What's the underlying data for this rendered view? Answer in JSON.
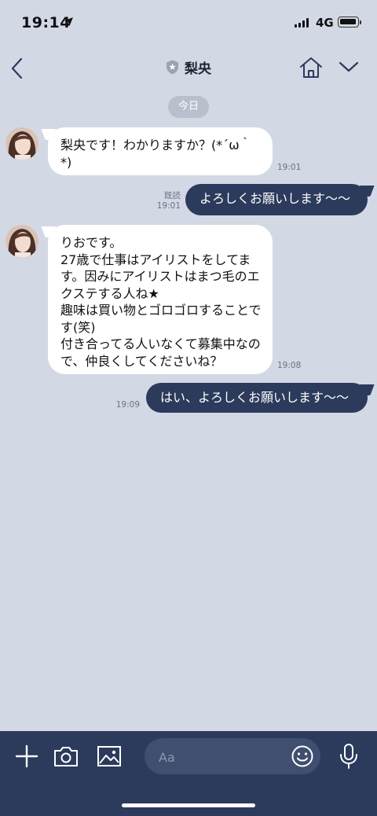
{
  "status": {
    "time": "19:14",
    "network": "4G"
  },
  "header": {
    "title": "梨央"
  },
  "date_label": "今日",
  "messages": [
    {
      "side": "in",
      "text": "梨央です！わかりますか？(*´ω｀*)",
      "time": "19:01"
    },
    {
      "side": "out",
      "text": "よろしくお願いします〜〜",
      "read": "既読",
      "time": "19:01"
    },
    {
      "side": "in",
      "text": "りおです。\n27歳で仕事はアイリストをしてます。因みにアイリストはまつ毛のエクステする人ね★\n趣味は買い物とゴロゴロすることです(笑)\n付き合ってる人いなくて募集中なので、仲良くしてくださいね？",
      "time": "19:08"
    },
    {
      "side": "out",
      "text": "はい、よろしくお願いします〜〜",
      "time": "19:09"
    }
  ],
  "input": {
    "placeholder": "Aa"
  },
  "colors": {
    "background": "#d3d8e5",
    "outgoing_bubble": "#2c3a5c",
    "incoming_bubble": "#ffffff",
    "toolbar": "#2c3a5c"
  }
}
